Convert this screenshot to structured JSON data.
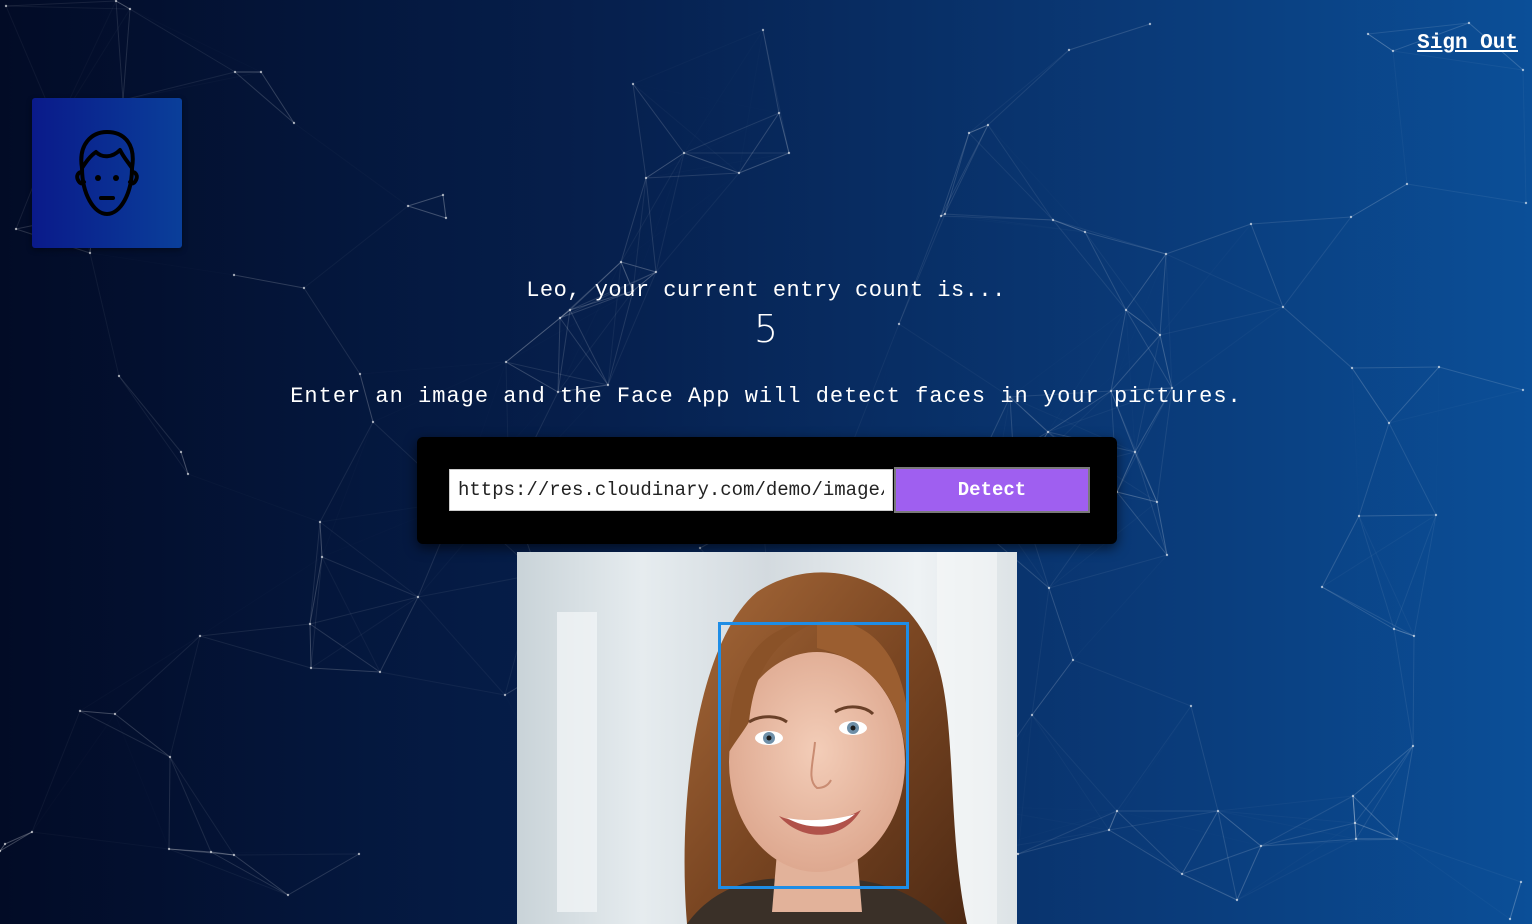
{
  "header": {
    "sign_out_label": "Sign Out"
  },
  "logo": {
    "icon": "face-icon"
  },
  "rank": {
    "message": "Leo, your current entry count is...",
    "count": "5"
  },
  "instruction": "Enter an image and the Face App will detect faces in your pictures.",
  "form": {
    "url_value": "https://res.cloudinary.com/demo/image/upload/woman.jpg",
    "detect_label": "Detect"
  },
  "result": {
    "faces_detected": 1
  },
  "colors": {
    "background_start": "#020b26",
    "background_end": "#0b4f98",
    "button": "#9f5ff0",
    "face_box": "#1e8de6",
    "logo_bg": "#0a1a8a"
  }
}
